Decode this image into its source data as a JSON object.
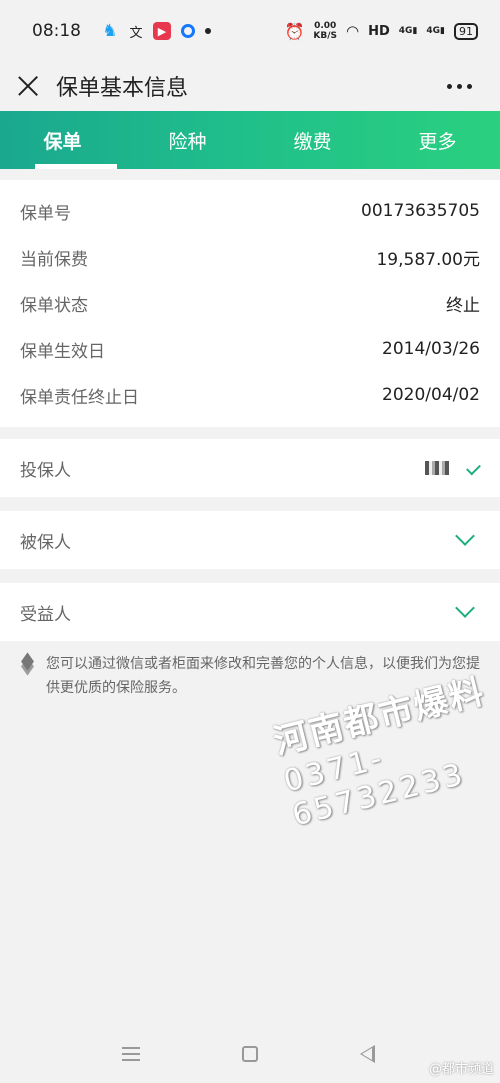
{
  "status_bar": {
    "time": "08:18",
    "net_speed_value": "0.00",
    "net_speed_unit": "KB/S",
    "hd": "HD",
    "signal1": "4G",
    "signal2": "4G",
    "battery": "91"
  },
  "header": {
    "title": "保单基本信息"
  },
  "tabs": [
    {
      "label": "保单"
    },
    {
      "label": "险种"
    },
    {
      "label": "缴费"
    },
    {
      "label": "更多"
    }
  ],
  "policy_info": [
    {
      "label": "保单号",
      "value": "00173635705"
    },
    {
      "label": "当前保费",
      "value": "19,587.00元"
    },
    {
      "label": "保单状态",
      "value": "终止"
    },
    {
      "label": "保单生效日",
      "value": "2014/03/26"
    },
    {
      "label": "保单责任终止日",
      "value": "2020/04/02"
    }
  ],
  "sections": [
    {
      "label": "投保人"
    },
    {
      "label": "被保人"
    },
    {
      "label": "受益人"
    }
  ],
  "notice": "您可以通过微信或者柜面来修改和完善您的个人信息，以便我们为您提供更优质的保险服务。",
  "watermark": {
    "line1": "河南都市爆料",
    "line2": "0371-65732233"
  },
  "weibo_mark": "@都市频道",
  "colors": {
    "accent": "#1fae7e",
    "tab_gradient_start": "#1aa88f",
    "tab_gradient_end": "#2bd07f"
  }
}
